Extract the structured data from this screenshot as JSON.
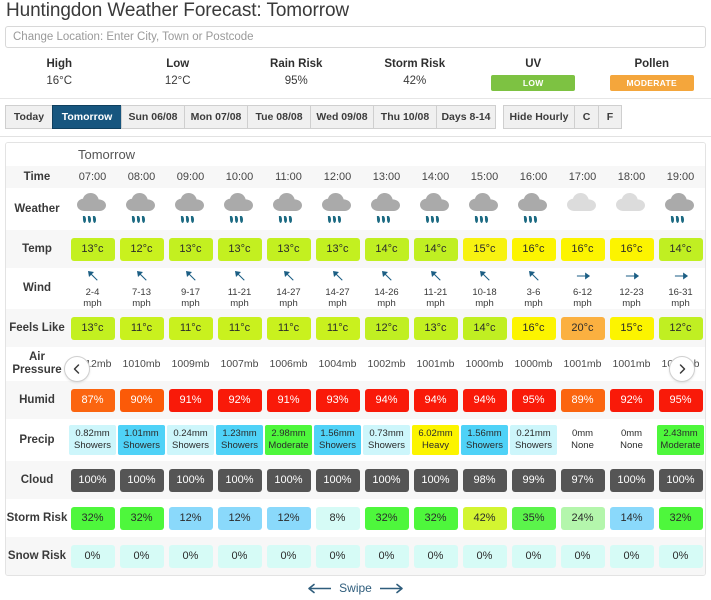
{
  "page_title": "Huntingdon Weather Forecast: Tomorrow",
  "location_search": {
    "placeholder": "Change Location: Enter City, Town or Postcode",
    "value": ""
  },
  "summary": [
    {
      "label": "High",
      "value": "16°C",
      "type": "text"
    },
    {
      "label": "Low",
      "value": "12°C",
      "type": "text"
    },
    {
      "label": "Rain Risk",
      "value": "95%",
      "type": "text"
    },
    {
      "label": "Storm Risk",
      "value": "42%",
      "type": "text"
    },
    {
      "label": "UV",
      "value": "LOW",
      "type": "badge",
      "color": "#7dc242"
    },
    {
      "label": "Pollen",
      "value": "MODERATE",
      "type": "badge",
      "color": "#f4a63c"
    }
  ],
  "tabs": {
    "days": [
      {
        "label": "Today",
        "active": false,
        "width": "w-today"
      },
      {
        "label": "Tomorrow",
        "active": true,
        "width": "w-tmr"
      },
      {
        "label": "Sun 06/08",
        "active": false,
        "width": "w-day"
      },
      {
        "label": "Mon 07/08",
        "active": false,
        "width": "w-day"
      },
      {
        "label": "Tue 08/08",
        "active": false,
        "width": "w-day"
      },
      {
        "label": "Wed 09/08",
        "active": false,
        "width": "w-day"
      },
      {
        "label": "Thu 10/08",
        "active": false,
        "width": "w-day"
      },
      {
        "label": "Days 8-14",
        "active": false,
        "width": "w-days"
      }
    ],
    "controls": [
      {
        "label": "Hide Hourly",
        "active": false,
        "width": "w-hide"
      },
      {
        "label": "C",
        "active": false,
        "width": "w-unit"
      },
      {
        "label": "F",
        "active": false,
        "width": "w-unit"
      }
    ]
  },
  "day_label": "Tomorrow",
  "nav": {
    "prev": "‹",
    "next": "›"
  },
  "swipe_label": "Swipe",
  "row_labels": {
    "time": "Time",
    "weather": "Weather",
    "temp": "Temp",
    "wind": "Wind",
    "feels_like": "Feels Like",
    "air_pressure": "Air Pressure",
    "humidity": "Humid",
    "precip": "Precip",
    "cloud": "Cloud",
    "storm_risk": "Storm Risk",
    "snow_risk": "Snow Risk"
  },
  "chart_data": {
    "type": "table",
    "title": "Huntingdon Weather Forecast: Tomorrow",
    "x": [
      "07:00",
      "08:00",
      "09:00",
      "10:00",
      "11:00",
      "12:00",
      "13:00",
      "14:00",
      "15:00",
      "16:00",
      "17:00",
      "18:00",
      "19:00"
    ],
    "series": [
      {
        "name": "Weather",
        "values": [
          "rain",
          "rain",
          "rain",
          "rain",
          "rain",
          "rain",
          "rain",
          "rain",
          "rain",
          "rain",
          "cloud",
          "cloud",
          "rain"
        ]
      },
      {
        "name": "Temp",
        "values": [
          "13°c",
          "12°c",
          "13°c",
          "13°c",
          "13°c",
          "13°c",
          "14°c",
          "14°c",
          "15°c",
          "16°c",
          "16°c",
          "16°c",
          "14°c"
        ]
      },
      {
        "name": "Wind",
        "values": [
          "2-4 mph",
          "7-13 mph",
          "9-17 mph",
          "11-21 mph",
          "14-27 mph",
          "14-27 mph",
          "14-26 mph",
          "11-21 mph",
          "10-18 mph",
          "3-6 mph",
          "6-12 mph",
          "12-23 mph",
          "16-31 mph"
        ]
      },
      {
        "name": "Wind Direction",
        "values": [
          "NE",
          "NE",
          "NE",
          "NE",
          "NE",
          "NE",
          "NE",
          "NE",
          "NE",
          "NE",
          "S",
          "S",
          "S"
        ]
      },
      {
        "name": "Feels Like",
        "values": [
          "13°c",
          "11°c",
          "11°c",
          "11°c",
          "11°c",
          "11°c",
          "12°c",
          "13°c",
          "14°c",
          "16°c",
          "20°c",
          "15°c",
          "12°c"
        ]
      },
      {
        "name": "Air Pressure",
        "values": [
          "1012mb",
          "1010mb",
          "1009mb",
          "1007mb",
          "1006mb",
          "1004mb",
          "1002mb",
          "1001mb",
          "1000mb",
          "1000mb",
          "1001mb",
          "1001mb",
          "1003mb"
        ]
      },
      {
        "name": "Humidity",
        "values": [
          "87%",
          "90%",
          "91%",
          "92%",
          "91%",
          "93%",
          "94%",
          "94%",
          "94%",
          "95%",
          "89%",
          "92%",
          "95%"
        ]
      },
      {
        "name": "Precip Amount",
        "values": [
          "0.82mm",
          "1.01mm",
          "0.24mm",
          "1.23mm",
          "2.98mm",
          "1.56mm",
          "0.73mm",
          "6.02mm",
          "1.56mm",
          "0.21mm",
          "0mm",
          "0mm",
          "2.43mm"
        ]
      },
      {
        "name": "Precip Type",
        "values": [
          "Showers",
          "Showers",
          "Showers",
          "Showers",
          "Moderate",
          "Showers",
          "Showers",
          "Heavy",
          "Showers",
          "Showers",
          "None",
          "None",
          "Moderate"
        ]
      },
      {
        "name": "Cloud",
        "values": [
          "100%",
          "100%",
          "100%",
          "100%",
          "100%",
          "100%",
          "100%",
          "100%",
          "98%",
          "99%",
          "97%",
          "100%",
          "100%"
        ]
      },
      {
        "name": "Storm Risk",
        "values": [
          "32%",
          "32%",
          "12%",
          "12%",
          "12%",
          "8%",
          "32%",
          "32%",
          "42%",
          "35%",
          "24%",
          "14%",
          "32%"
        ]
      },
      {
        "name": "Snow Risk",
        "values": [
          "0%",
          "0%",
          "0%",
          "0%",
          "0%",
          "0%",
          "0%",
          "0%",
          "0%",
          "0%",
          "0%",
          "0%",
          "0%"
        ]
      }
    ]
  },
  "cell_colors": {
    "temp": [
      "#c3f020",
      "#c9f11e",
      "#c3f020",
      "#c3f020",
      "#c3f020",
      "#c3f020",
      "#c0ef22",
      "#c0ef22",
      "#f7f211",
      "#fcf400",
      "#fcf400",
      "#fcf400",
      "#c0ef22"
    ],
    "feels": [
      "#c3f020",
      "#c9f11e",
      "#c9f11e",
      "#c9f11e",
      "#c9f11e",
      "#c9f11e",
      "#c0ef22",
      "#c3f020",
      "#c0ef22",
      "#fcf400",
      "#fbb040",
      "#fcf400",
      "#c0ef22"
    ],
    "humid": [
      "#fb6510",
      "#fb5a08",
      "#f91a09",
      "#f91a09",
      "#f91a09",
      "#f91a09",
      "#f91a09",
      "#f91a09",
      "#f91a09",
      "#f91a09",
      "#fb6510",
      "#f91a09",
      "#f91a09"
    ],
    "precip": [
      "#cdf6fb",
      "#4fd2f7",
      "#cdf6fb",
      "#4fd2f7",
      "#4ef73c",
      "#4fd2f7",
      "#cdf6fb",
      "#fcf400",
      "#4fd2f7",
      "#cdf6fb",
      "#ffffff",
      "#ffffff",
      "#4ef73c"
    ],
    "cloud": [
      "#555555",
      "#555555",
      "#555555",
      "#555555",
      "#555555",
      "#555555",
      "#555555",
      "#555555",
      "#555555",
      "#555555",
      "#555555",
      "#555555",
      "#555555"
    ],
    "storm": [
      "#4ef73c",
      "#4ef73c",
      "#8ad9fb",
      "#8ad9fb",
      "#8ad9fb",
      "#d6fbf6",
      "#4ef73c",
      "#4ef73c",
      "#d3f531",
      "#5bf44b",
      "#b4f6ac",
      "#8ad9fb",
      "#4ef73c"
    ],
    "snow": [
      "#d6fbf6",
      "#d6fbf6",
      "#d6fbf6",
      "#d6fbf6",
      "#d6fbf6",
      "#d6fbf6",
      "#d6fbf6",
      "#d6fbf6",
      "#d6fbf6",
      "#d6fbf6",
      "#d6fbf6",
      "#d6fbf6",
      "#d6fbf6"
    ]
  },
  "icons": {
    "cloud": "cloud-icon",
    "rain": "rain-cloud-icon",
    "wind_arrow": "wind-direction-arrow-icon",
    "prev": "chevron-left-icon",
    "next": "chevron-right-icon",
    "swipe_left": "arrow-left-icon",
    "swipe_right": "arrow-right-icon"
  }
}
